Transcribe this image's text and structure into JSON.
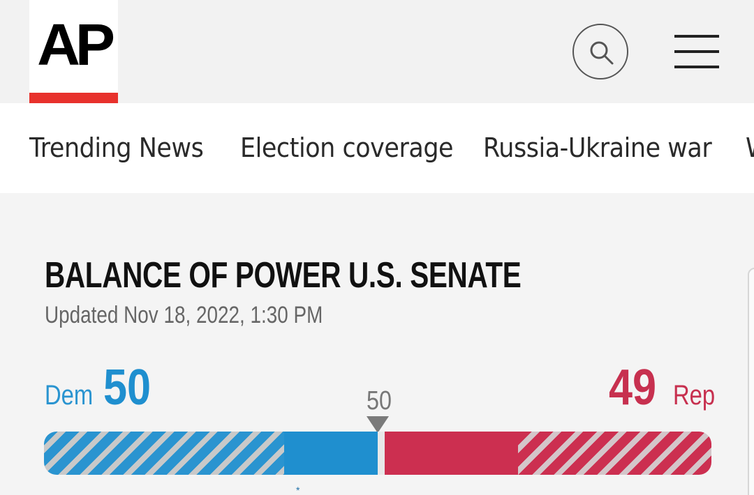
{
  "header": {
    "logo_text": "AP",
    "search_icon": "search-icon",
    "menu_icon": "hamburger-menu-icon",
    "brand_accent": "#e8312c"
  },
  "nav": {
    "items": [
      {
        "label": "Trending News"
      },
      {
        "label": "Election coverage"
      },
      {
        "label": "Russia-Ukraine war"
      },
      {
        "label": "W"
      }
    ]
  },
  "senate": {
    "title": "BALANCE OF POWER U.S. SENATE",
    "updated": "Updated Nov 18, 2022, 1:30 PM",
    "dem": {
      "label": "Dem",
      "seats": "50",
      "color": "#1f8fcf"
    },
    "rep": {
      "label": "Rep",
      "seats": "49",
      "color": "#cc2f50"
    },
    "majority": "50",
    "footnote_marker": "*",
    "bar": {
      "total_seats": 100,
      "segments": [
        {
          "party": "dem",
          "status": "not-up-for-election",
          "seats": 36
        },
        {
          "party": "dem",
          "status": "won",
          "seats": 14
        },
        {
          "party": "undecided",
          "status": "undecided",
          "seats": 1
        },
        {
          "party": "rep",
          "status": "won",
          "seats": 20
        },
        {
          "party": "rep",
          "status": "not-up-for-election",
          "seats": 29
        }
      ]
    }
  }
}
